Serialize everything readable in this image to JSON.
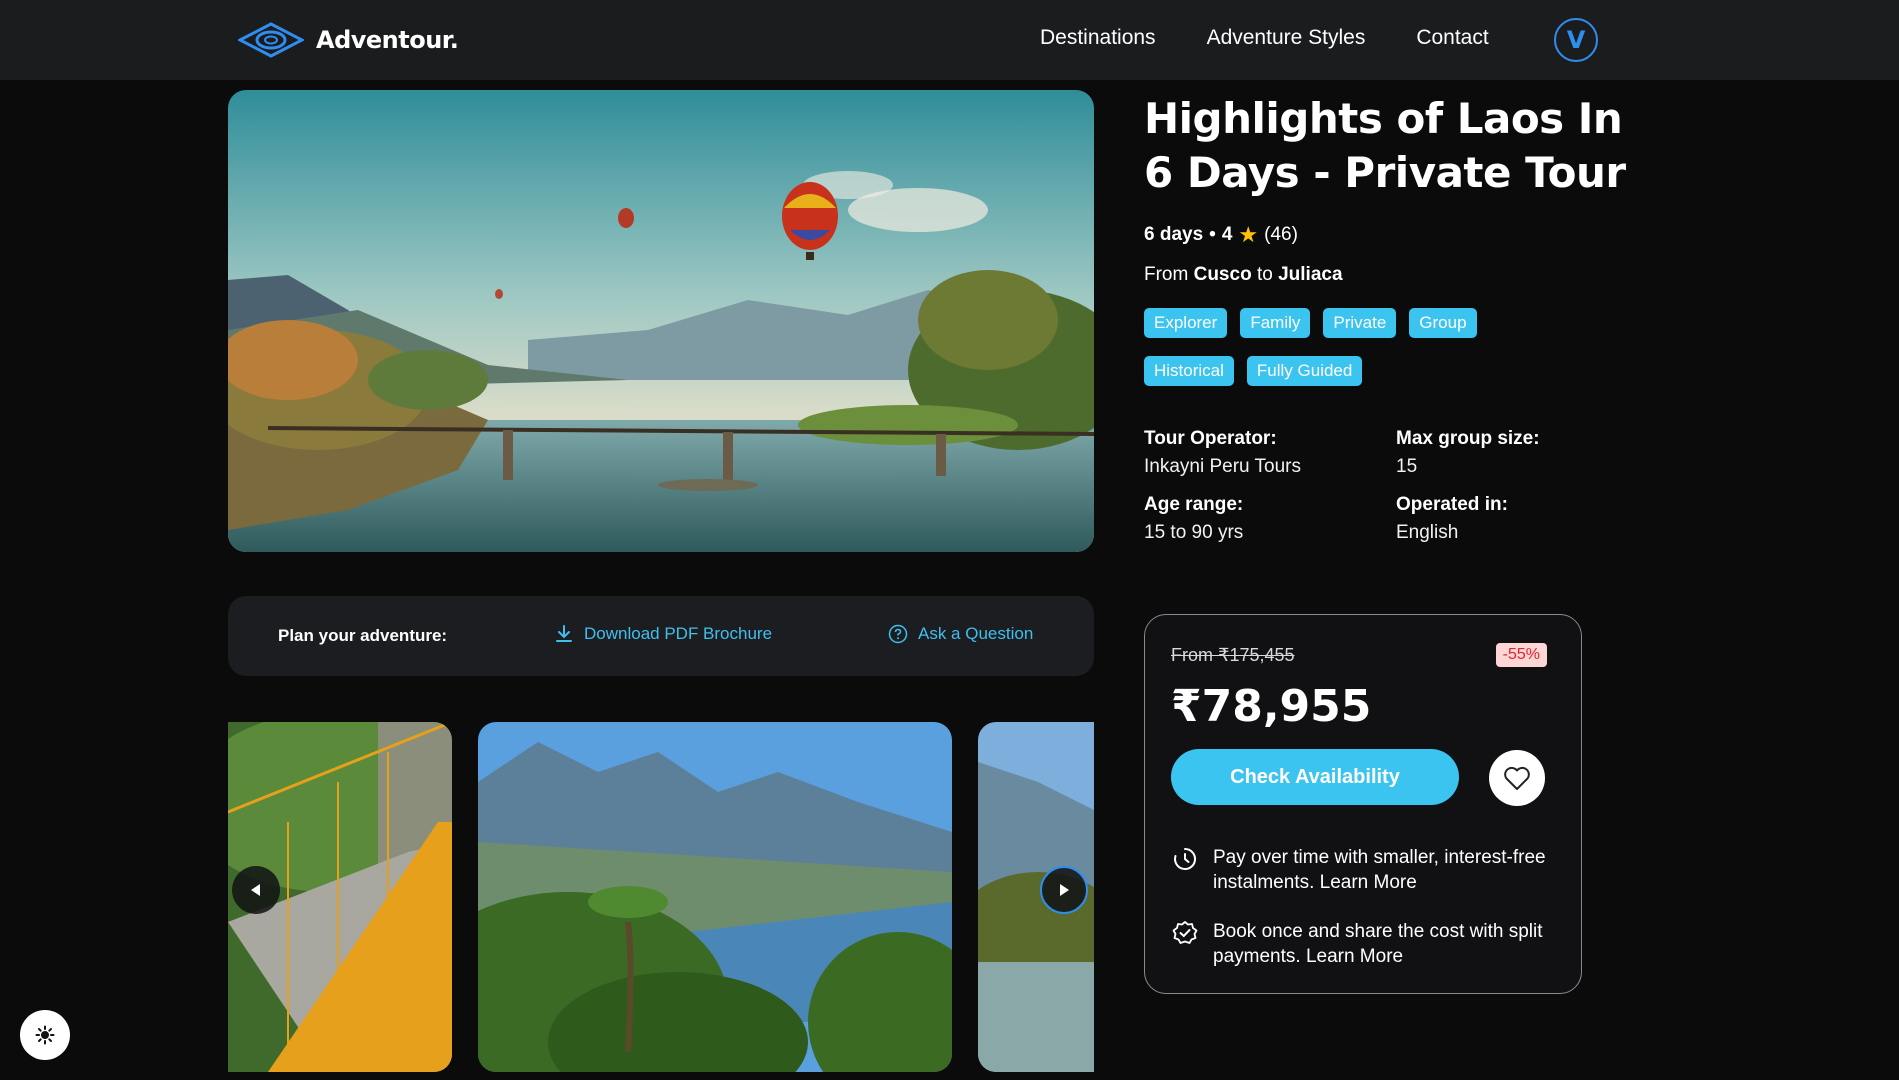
{
  "header": {
    "brand": "Adventour.",
    "nav": [
      "Destinations",
      "Adventure Styles",
      "Contact"
    ],
    "avatar_letter": "V"
  },
  "plan": {
    "label": "Plan your adventure:",
    "download": "Download PDF Brochure",
    "ask": "Ask a Question"
  },
  "tour": {
    "title": "Highlights of Laos In 6 Days - Private Tour",
    "duration": "6 days",
    "separator": "•",
    "rating": "4",
    "reviews": "(46)",
    "from_word": "From",
    "from_city": "Cusco",
    "to_word": "to",
    "to_city": "Juliaca",
    "tags": [
      "Explorer",
      "Family",
      "Private",
      "Group",
      "Historical",
      "Fully Guided"
    ],
    "facts": [
      {
        "label": "Tour Operator:",
        "value": "Inkayni Peru Tours"
      },
      {
        "label": "Max group size:",
        "value": "15"
      },
      {
        "label": "Age range:",
        "value": "15 to 90 yrs"
      },
      {
        "label": "Operated in:",
        "value": "English"
      }
    ]
  },
  "pricing": {
    "was": "From ₹175,455",
    "discount": "-55%",
    "price": "₹78,955",
    "cta": "Check Availability",
    "perk1_text": "Pay over time with smaller, interest-free instalments.",
    "perk1_link": "Learn More",
    "perk2_text": "Book once and share the cost with split payments.",
    "perk2_link": "Learn More"
  },
  "colors": {
    "accent": "#3cc4f0",
    "brand_blue": "#2f8df0",
    "header_bg": "#1b1c1e",
    "page_bg": "#0b0b0c",
    "discount_text": "#e0242c"
  }
}
